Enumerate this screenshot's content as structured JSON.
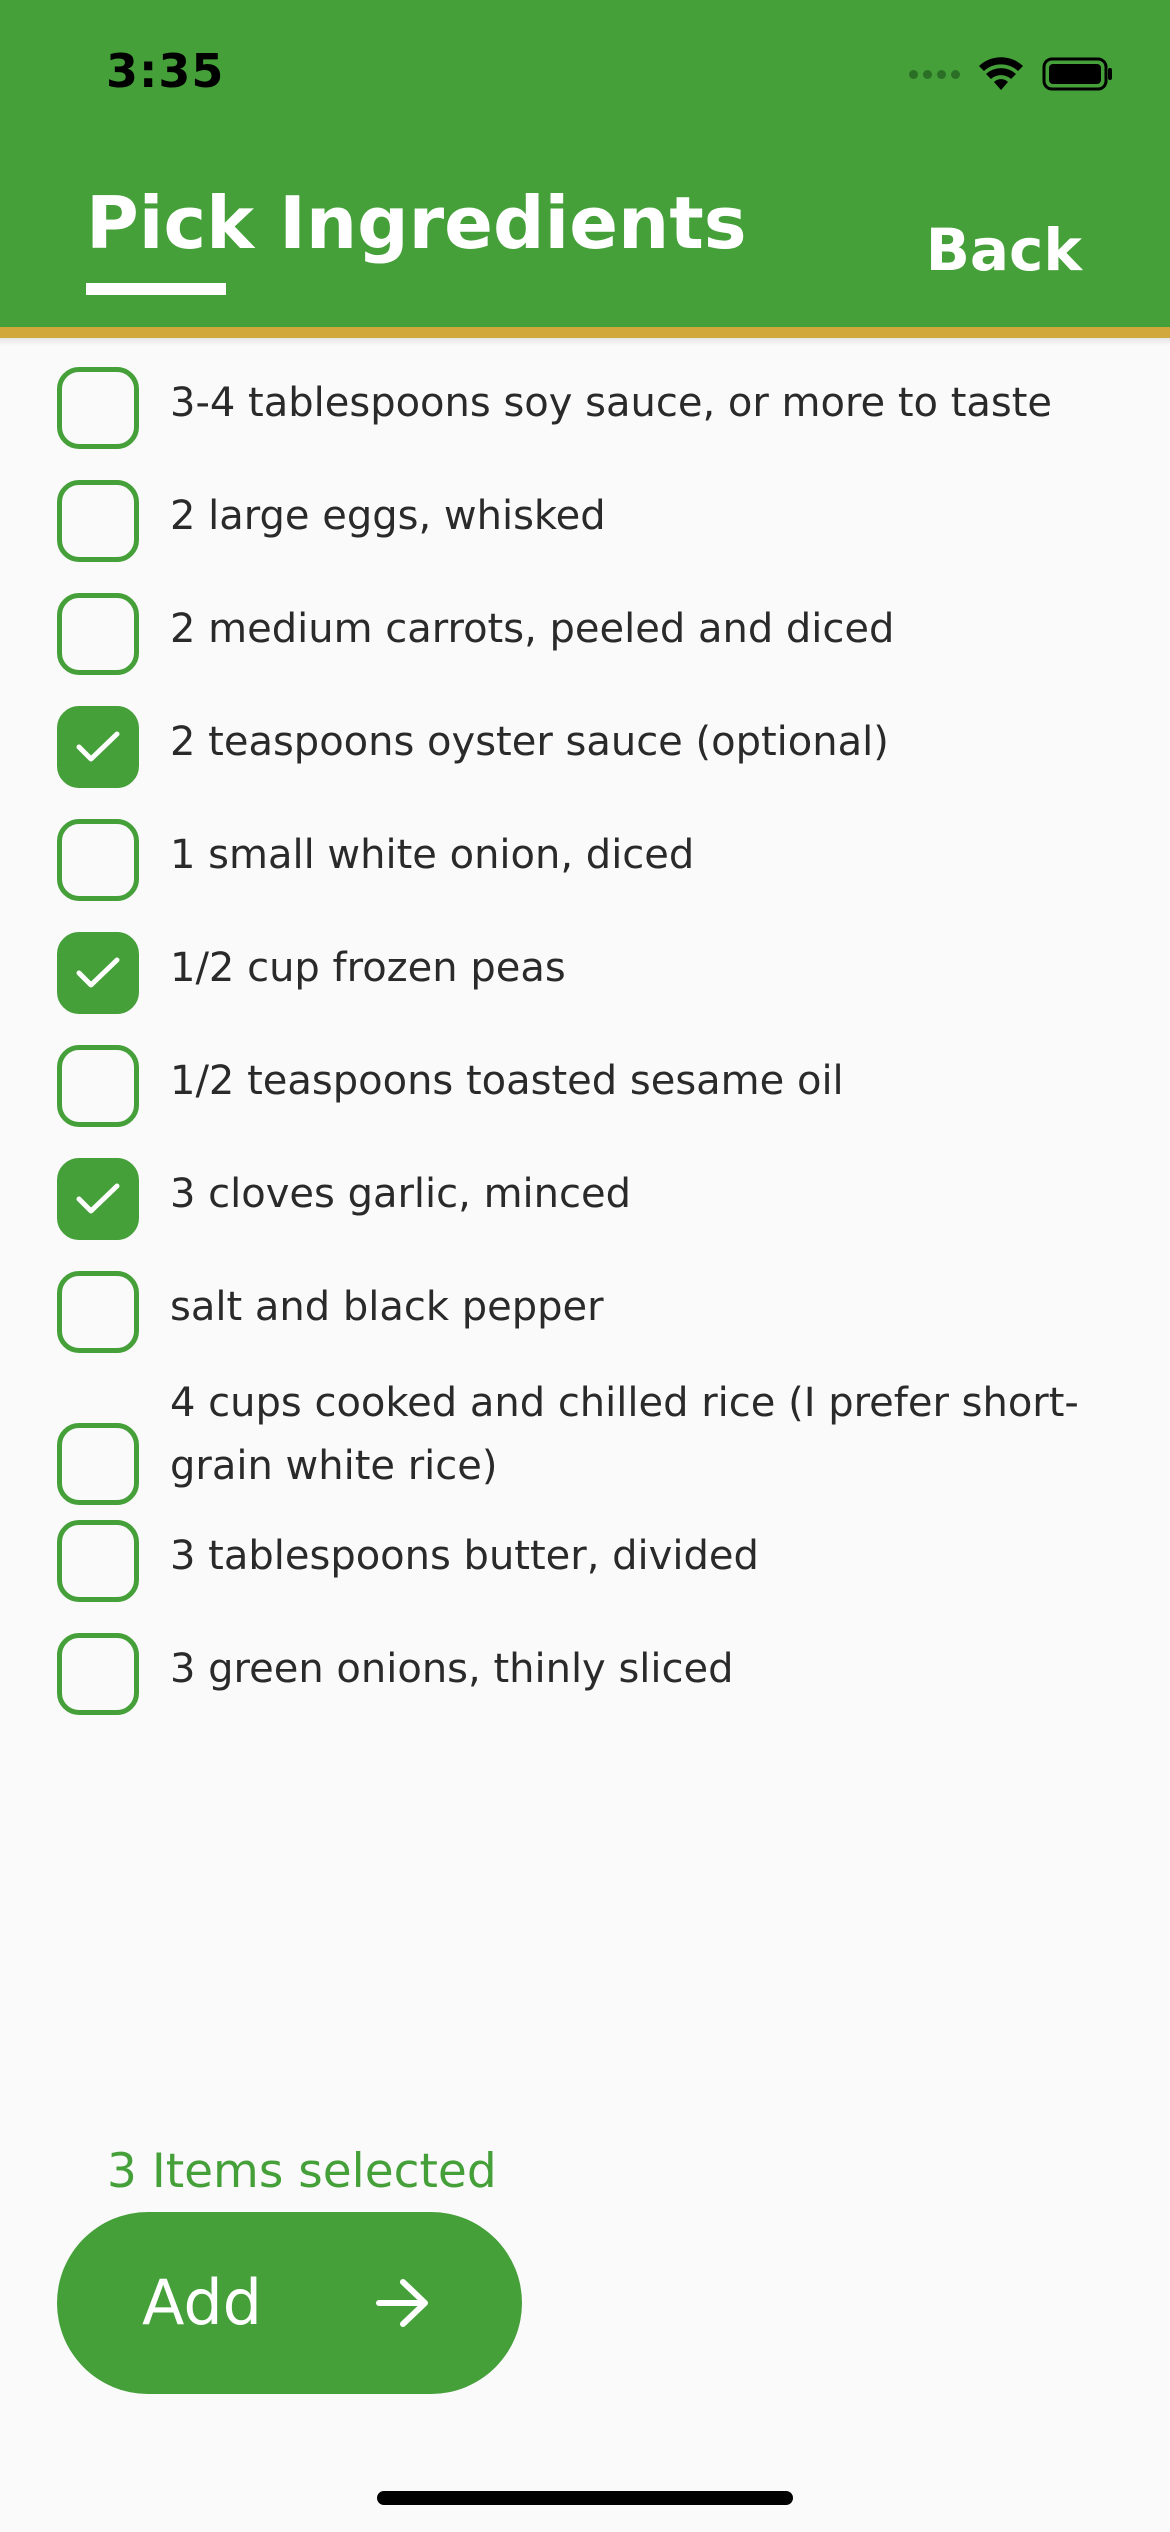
{
  "status_bar": {
    "time": "3:35"
  },
  "header": {
    "title": "Pick Ingredients",
    "back_label": "Back"
  },
  "ingredients": [
    {
      "label": "3-4 tablespoons soy sauce, or more to taste",
      "checked": false
    },
    {
      "label": "2 large eggs, whisked",
      "checked": false
    },
    {
      "label": "2 medium carrots, peeled and diced",
      "checked": false
    },
    {
      "label": "2 teaspoons oyster sauce (optional)",
      "checked": true
    },
    {
      "label": "1 small white onion, diced",
      "checked": false
    },
    {
      "label": "1/2 cup frozen peas",
      "checked": true
    },
    {
      "label": "1/2 teaspoons toasted sesame oil",
      "checked": false
    },
    {
      "label": "3 cloves garlic, minced",
      "checked": true
    },
    {
      "label": "salt and black pepper",
      "checked": false
    },
    {
      "label": "4 cups cooked and chilled rice (I prefer short-grain white rice)",
      "checked": false
    },
    {
      "label": "3 tablespoons butter, divided",
      "checked": false
    },
    {
      "label": "3 green onions, thinly sliced",
      "checked": false
    }
  ],
  "footer": {
    "selected_text": "3 Items selected",
    "add_label": "Add"
  },
  "colors": {
    "primary_green": "#45a03a",
    "header_accent": "#d1a83c",
    "background": "#fafafa"
  }
}
